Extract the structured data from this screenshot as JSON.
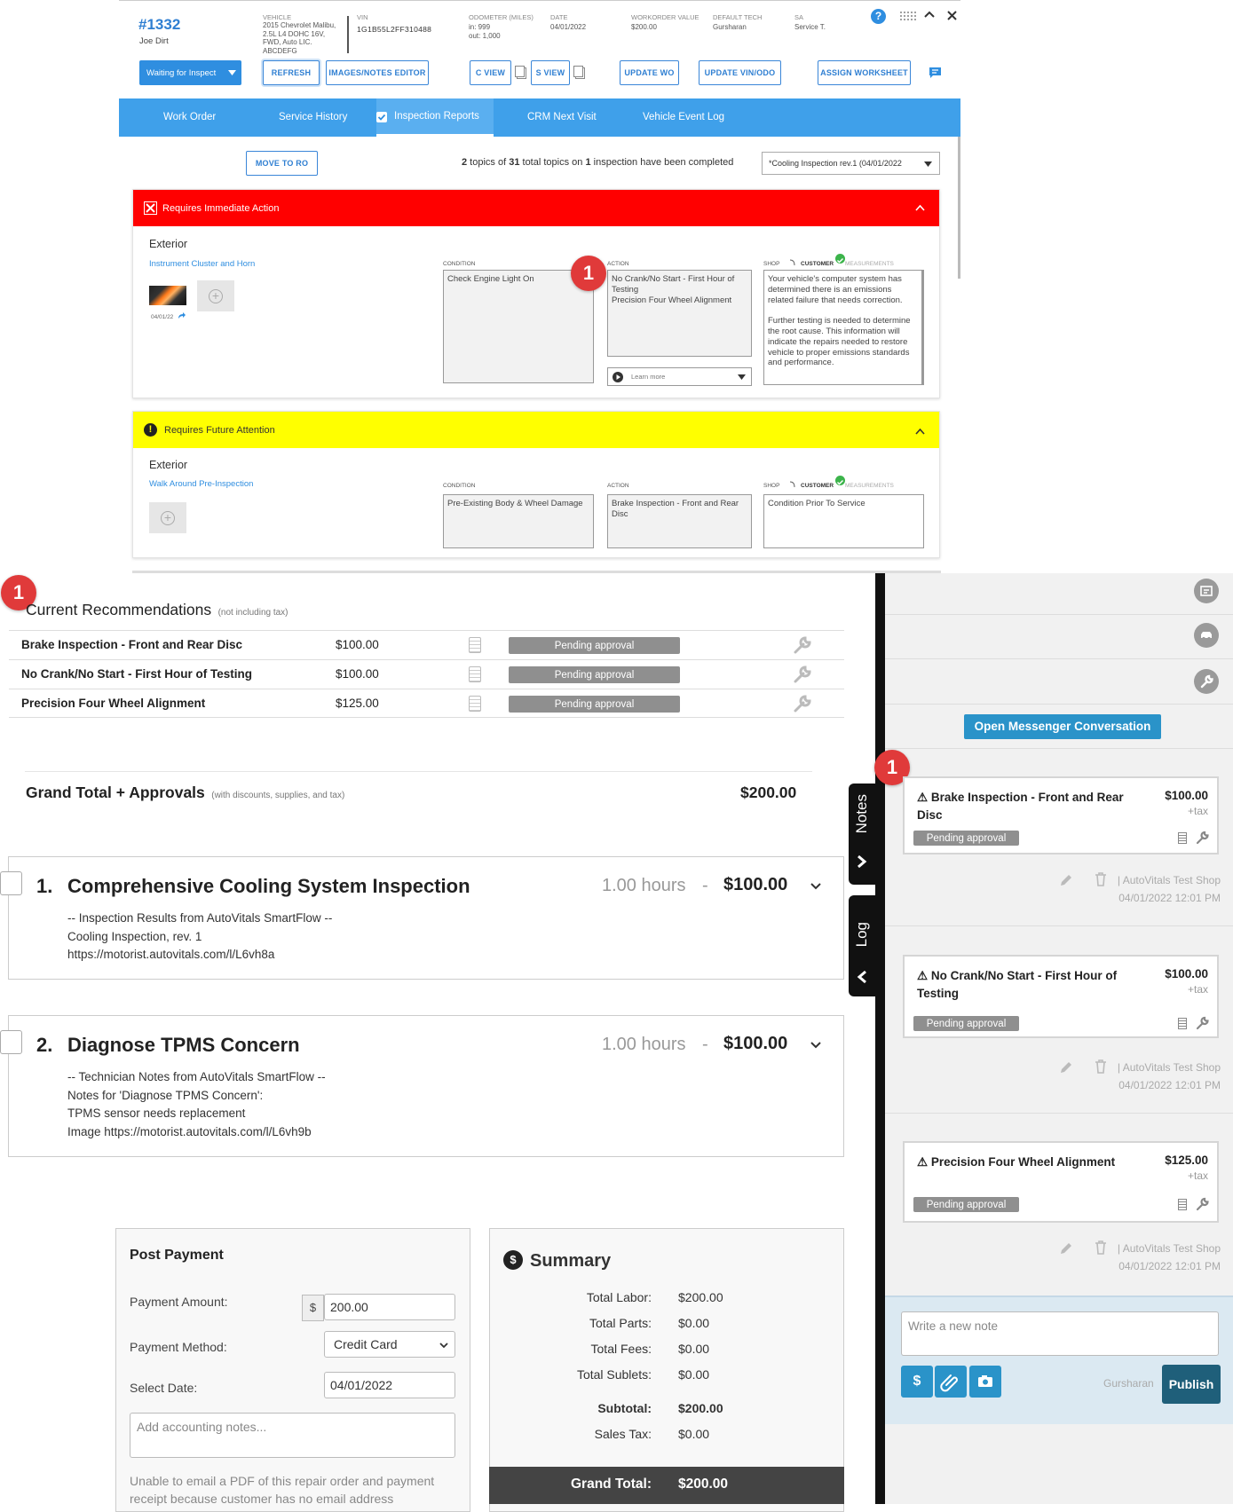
{
  "header": {
    "ro_number": "#1332",
    "customer": "Joe Dirt",
    "vehicle_label": "VEHICLE",
    "vehicle_lines": [
      "2015 Chevrolet Malibu,",
      "2.5L L4 DOHC 16V,",
      "FWD, Auto LIC.",
      "ABCDEFG"
    ],
    "vin_label": "VIN",
    "vin_value": "1G1B55L2FF310488",
    "odometer_label": "ODOMETER (MILES)",
    "odometer_in": "in: 999",
    "odometer_out": "out: 1,000",
    "date_label": "DATE",
    "date_value": "04/01/2022",
    "wo_value_label": "WORKORDER VALUE",
    "wo_value": "$200.00",
    "tech_label": "DEFAULT TECH",
    "tech_value": "Gursharan",
    "sa_label": "SA",
    "sa_value": "Service T.",
    "status_button": "Waiting for Inspect",
    "buttons": {
      "refresh": "REFRESH",
      "images_notes": "IMAGES/NOTES EDITOR",
      "c_view": "C VIEW",
      "s_view": "S VIEW",
      "update_wo": "UPDATE WO",
      "update_vin": "UPDATE VIN/ODO",
      "assign_worksheet": "ASSIGN WORKSHEET"
    }
  },
  "tabs": [
    "Work Order",
    "Service History",
    "Inspection Reports",
    "CRM Next Visit",
    "Vehicle Event Log"
  ],
  "inspection": {
    "move_to_ro": "MOVE TO RO",
    "summary_parts": [
      "2",
      " topics of ",
      "31",
      " total topics on ",
      "1",
      " inspection have been completed"
    ],
    "select_value": "*Cooling Inspection rev.1 (04/01/2022",
    "immediate": {
      "heading": "Requires Immediate Action",
      "category": "Exterior",
      "topic": "Instrument Cluster and Horn",
      "photo_date": "04/01/22",
      "condition_label": "CONDITION",
      "condition": "Check Engine Light On",
      "action_label": "ACTION",
      "action": "No Crank/No Start - First Hour of Testing\nPrecision Four Wheel Alignment",
      "learn_more": "Learn more",
      "shop_label": "SHOP",
      "customer_label": "CUSTOMER",
      "measurements_label": "MEASUREMENTS",
      "customer_text": "Your vehicle's computer system has determined there is an emissions related failure that needs correction.\n\nFurther testing is needed to determine the root cause. This information will indicate the repairs needed to restore vehicle to proper emissions standards and performance."
    },
    "future": {
      "heading": "Requires Future Attention",
      "category": "Exterior",
      "topic": "Walk Around Pre-Inspection",
      "condition_label": "CONDITION",
      "condition": "Pre-Existing Body & Wheel Damage",
      "action_label": "ACTION",
      "action": "Brake Inspection - Front and Rear Disc",
      "shop_label": "SHOP",
      "customer_label": "CUSTOMER",
      "measurements_label": "MEASUREMENTS",
      "customer_text": "Condition Prior To Service"
    }
  },
  "badge_number": "1",
  "recommendations": {
    "title": "Current Recommendations",
    "subtitle": "(not including tax)",
    "rows": [
      {
        "name": "Brake Inspection - Front and Rear Disc",
        "price": "$100.00",
        "status": "Pending approval"
      },
      {
        "name": "No Crank/No Start - First Hour of Testing",
        "price": "$100.00",
        "status": "Pending approval"
      },
      {
        "name": "Precision Four Wheel Alignment",
        "price": "$125.00",
        "status": "Pending approval"
      }
    ],
    "grand_total_label": "Grand Total + Approvals",
    "grand_total_sub": "(with discounts, supplies, and tax)",
    "grand_total_value": "$200.00"
  },
  "jobs": [
    {
      "number": "1.",
      "title": "Comprehensive Cooling System Inspection",
      "hours": "1.00 hours",
      "dash": "-",
      "price": "$100.00",
      "notes": "-- Inspection Results from AutoVitals SmartFlow --\nCooling Inspection, rev. 1\nhttps://motorist.autovitals.com/l/L6vh8a"
    },
    {
      "number": "2.",
      "title": "Diagnose TPMS Concern",
      "hours": "1.00 hours",
      "dash": "-",
      "price": "$100.00",
      "notes": "-- Technician Notes from AutoVitals SmartFlow --\nNotes for 'Diagnose TPMS Concern':\nTPMS sensor needs replacement\nImage https://motorist.autovitals.com/l/L6vh9b"
    }
  ],
  "payment": {
    "title": "Post Payment",
    "amount_label": "Payment Amount:",
    "currency": "$",
    "amount_value": "200.00",
    "method_label": "Payment Method:",
    "method_value": "Credit Card",
    "date_label": "Select Date:",
    "date_value": "04/01/2022",
    "notes_placeholder": "Add accounting notes...",
    "warning": "Unable to email a PDF of this repair order and payment receipt because customer has no email address"
  },
  "summary": {
    "title": "Summary",
    "rows": [
      {
        "label": "Total Labor:",
        "value": "$200.00"
      },
      {
        "label": "Total Parts:",
        "value": "$0.00"
      },
      {
        "label": "Total Fees:",
        "value": "$0.00"
      },
      {
        "label": "Total Sublets:",
        "value": "$0.00"
      }
    ],
    "subtotal_label": "Subtotal:",
    "subtotal_value": "$200.00",
    "tax_label": "Sales Tax:",
    "tax_value": "$0.00",
    "grand_label": "Grand Total:",
    "grand_value": "$200.00"
  },
  "side": {
    "notes_tab": "Notes",
    "log_tab": "Log",
    "messenger_button": "Open Messenger Conversation",
    "cards": [
      {
        "title": "Brake Inspection - Front and Rear Disc",
        "price": "$100.00",
        "tax": "+tax",
        "status": "Pending approval",
        "author": "| AutoVitals Test Shop",
        "timestamp": "04/01/2022 12:01 PM"
      },
      {
        "title": "No Crank/No Start - First Hour of Testing",
        "price": "$100.00",
        "tax": "+tax",
        "status": "Pending approval",
        "author": "| AutoVitals Test Shop",
        "timestamp": "04/01/2022 12:01 PM"
      },
      {
        "title": "Precision Four Wheel Alignment",
        "price": "$125.00",
        "tax": "+tax",
        "status": "Pending approval",
        "author": "| AutoVitals Test Shop",
        "timestamp": "04/01/2022 12:01 PM"
      }
    ],
    "note_placeholder": "Write a new note",
    "user": "Gursharan",
    "publish": "Publish"
  },
  "colors": {
    "accent": "#3fa0ea",
    "immediate": "#ff0000",
    "future": "#ffff00",
    "pending": "#8f8f8f",
    "badge": "#e03a3a",
    "publish": "#1f5f7a",
    "messenger": "#2a93c9"
  },
  "icons": [
    "help-icon",
    "grid-icon",
    "chevron-up-icon",
    "close-icon",
    "chat-icon",
    "copy-icon",
    "checkbox-icon",
    "x-icon",
    "warning-icon",
    "play-icon",
    "check-circle-icon",
    "plus-icon",
    "clipboard-icon",
    "wrench-icon",
    "pencil-icon",
    "trash-icon",
    "dollar-icon",
    "paperclip-icon",
    "camera-icon",
    "id-card-icon",
    "car-icon",
    "chevron-down-icon"
  ]
}
